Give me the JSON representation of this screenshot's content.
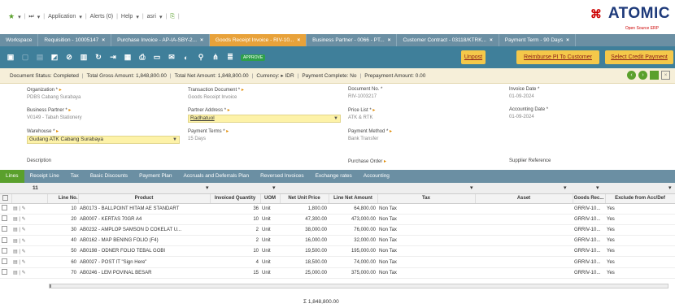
{
  "menubar": {
    "app_label": "Application",
    "alerts_label": "Alerts (0)",
    "help_label": "Help",
    "user_label": "asri"
  },
  "brand": {
    "name": "ATOMIC",
    "tagline": "Open Source ERP"
  },
  "tabs": [
    {
      "label": "Workspace"
    },
    {
      "label": "Requisition - 10005147"
    },
    {
      "label": "Purchase Invoice - AP-IA-SBY-2..."
    },
    {
      "label": "Goods Receipt Invoice - RIV-10..."
    },
    {
      "label": "Business Partner - 0066 - PT..."
    },
    {
      "label": "Customer Contract - 03118/KTRK..."
    },
    {
      "label": "Payment Term - 90 Days"
    }
  ],
  "toolbar": {
    "approve_label": "APPROVE",
    "unpost_label": "Unpost",
    "reimburse_label": "Reimburse PI To Customer",
    "credit_label": "Select Credit Payment"
  },
  "status": {
    "doc_status": "Document Status: Completed",
    "gross": "Total Gross Amount: 1,848,800.00",
    "net": "Total Net Amount: 1,848,800.00",
    "currency": "Currency: ▸ IDR",
    "paid": "Payment Complete: No",
    "prepay": "Prepayment Amount: 0.00"
  },
  "form": {
    "org_label": "Organization *",
    "org_value": "PDBS Cabang Surabaya",
    "txdoc_label": "Transaction Document *",
    "txdoc_value": "Goods Receipt Invoice",
    "docno_label": "Document No. *",
    "docno_value": "RIV-1003217",
    "invdate_label": "Invoice Date *",
    "invdate_value": "01-09-2024",
    "bp_label": "Business Partner *",
    "bp_value": "V0149 - Tabah Stationery",
    "paddr_label": "Partner Address *",
    "paddr_value": "Radhatuol",
    "pricelist_label": "Price List *",
    "pricelist_value": "ATK & RTK",
    "acctdate_label": "Accounting Date *",
    "acctdate_value": "01-09-2024",
    "wh_label": "Warehouse *",
    "wh_value": "Gudang ATK Cabang Surabaya",
    "payterm_label": "Payment Terms *",
    "payterm_value": "15 Days",
    "paymethod_label": "Payment Method *",
    "paymethod_value": "Bank Transfer",
    "desc_label": "Description",
    "po_label": "Purchase Order",
    "supref_label": "Supplier Reference"
  },
  "line_tabs": [
    "Lines",
    "Receipt Line",
    "Tax",
    "Basic Discounts",
    "Payment Plan",
    "Accruals and Deferrals Plan",
    "Reversed Invoices",
    "Exchange rates",
    "Accounting"
  ],
  "grid": {
    "count": "11",
    "headers": [
      "Line No.",
      "Product",
      "Invoiced Quantity",
      "UOM",
      "Net Unit Price",
      "Line Net Amount",
      "Tax",
      "Asset",
      "Goods Rec...",
      "Exclude from Acc/Def"
    ],
    "rows": [
      [
        "10",
        "AB0173 - BALLPOINT HITAM AE STANDART",
        "36",
        "Unit",
        "1,800.00",
        "64,800.00",
        "Non Tax",
        "",
        "GRRIV-10...",
        "Yes"
      ],
      [
        "20",
        "AB0007 - KERTAS 70GR A4",
        "10",
        "Unit",
        "47,300.00",
        "473,000.00",
        "Non Tax",
        "",
        "GRRIV-10...",
        "Yes"
      ],
      [
        "30",
        "AB0232 - AMPLOP SAMSON D COKELAT U...",
        "2",
        "Unit",
        "38,000.00",
        "76,000.00",
        "Non Tax",
        "",
        "GRRIV-10...",
        "Yes"
      ],
      [
        "40",
        "AB0162 - MAP BENING FOLIO (F4)",
        "2",
        "Unit",
        "16,000.00",
        "32,000.00",
        "Non Tax",
        "",
        "GRRIV-10...",
        "Yes"
      ],
      [
        "50",
        "AB0198 - ODNER FOLIO TEBAL GOBI",
        "10",
        "Unit",
        "19,500.00",
        "195,000.00",
        "Non Tax",
        "",
        "GRRIV-10...",
        "Yes"
      ],
      [
        "60",
        "AB0027 - POST IT \"Sign Here\"",
        "4",
        "Unit",
        "18,500.00",
        "74,000.00",
        "Non Tax",
        "",
        "GRRIV-10...",
        "Yes"
      ],
      [
        "70",
        "AB0246 - LEM POVINAL BESAR",
        "15",
        "Unit",
        "25,000.00",
        "375,000.00",
        "Non Tax",
        "",
        "GRRIV-10...",
        "Yes"
      ]
    ],
    "total": "Σ 1,848,800.00"
  }
}
